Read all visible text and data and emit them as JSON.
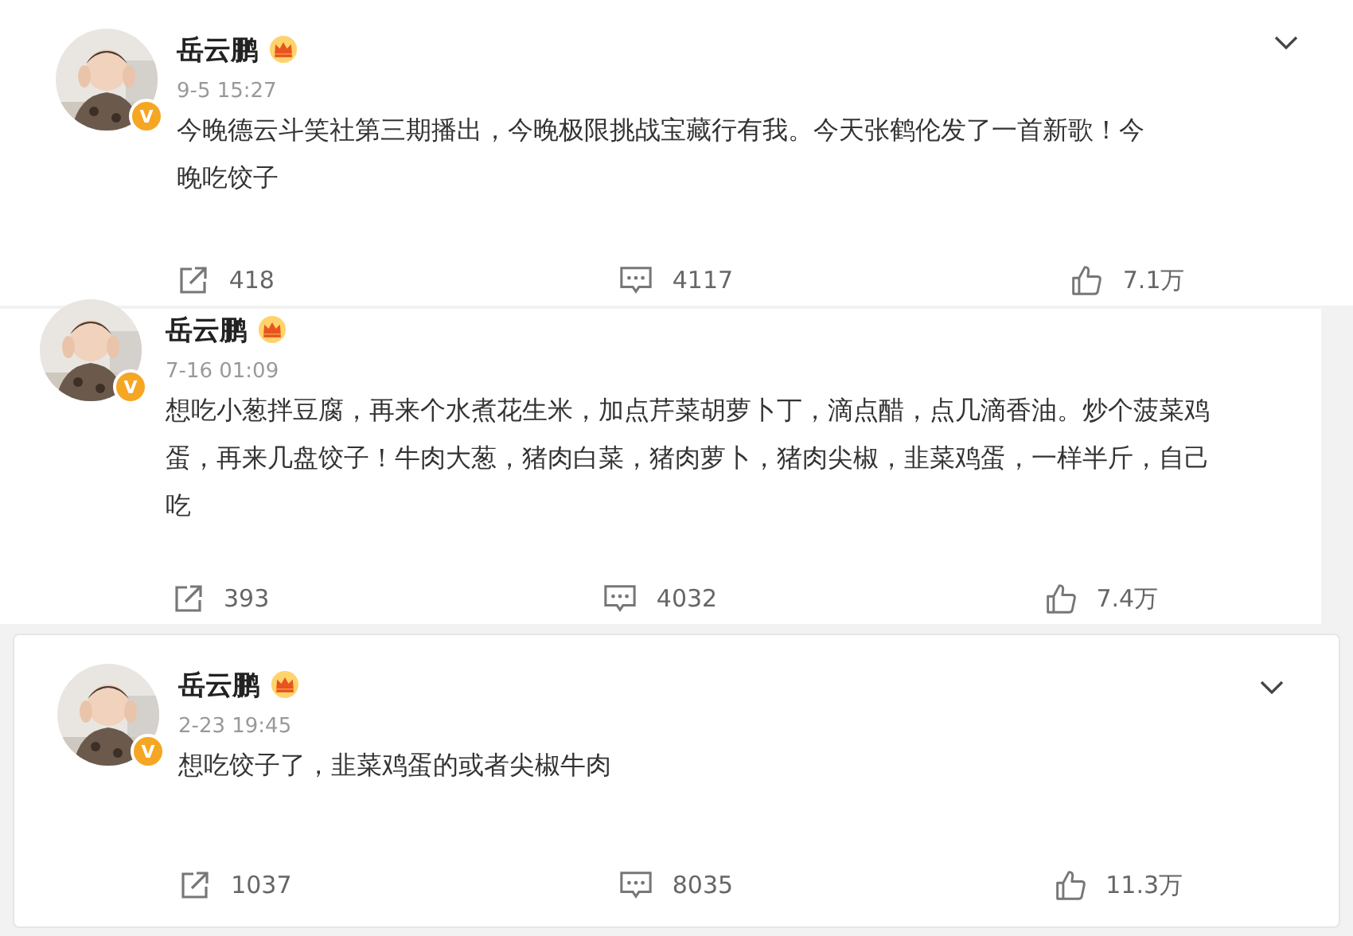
{
  "posts": [
    {
      "author": "岳云鹏",
      "badge": "V",
      "time": "9-5 15:27",
      "text": "今晚德云斗笑社第三期播出，今晚极限挑战宝藏行有我。今天张鹤伦发了一首新歌！今晚吃饺子",
      "shares": "418",
      "comments": "4117",
      "likes": "7.1万",
      "menu": true
    },
    {
      "author": "岳云鹏",
      "badge": "V",
      "time": "7-16 01:09",
      "text": "想吃小葱拌豆腐，再来个水煮花生米，加点芹菜胡萝卜丁，滴点醋，点几滴香油。炒个菠菜鸡蛋，再来几盘饺子！牛肉大葱，猪肉白菜，猪肉萝卜，猪肉尖椒，韭菜鸡蛋，一样半斤，自己吃",
      "shares": "393",
      "comments": "4032",
      "likes": "7.4万",
      "menu": false
    },
    {
      "author": "岳云鹏",
      "badge": "V",
      "time": "2-23 19:45",
      "text": "想吃饺子了，韭菜鸡蛋的或者尖椒牛肉",
      "shares": "1037",
      "comments": "8035",
      "likes": "11.3万",
      "menu": true
    }
  ]
}
